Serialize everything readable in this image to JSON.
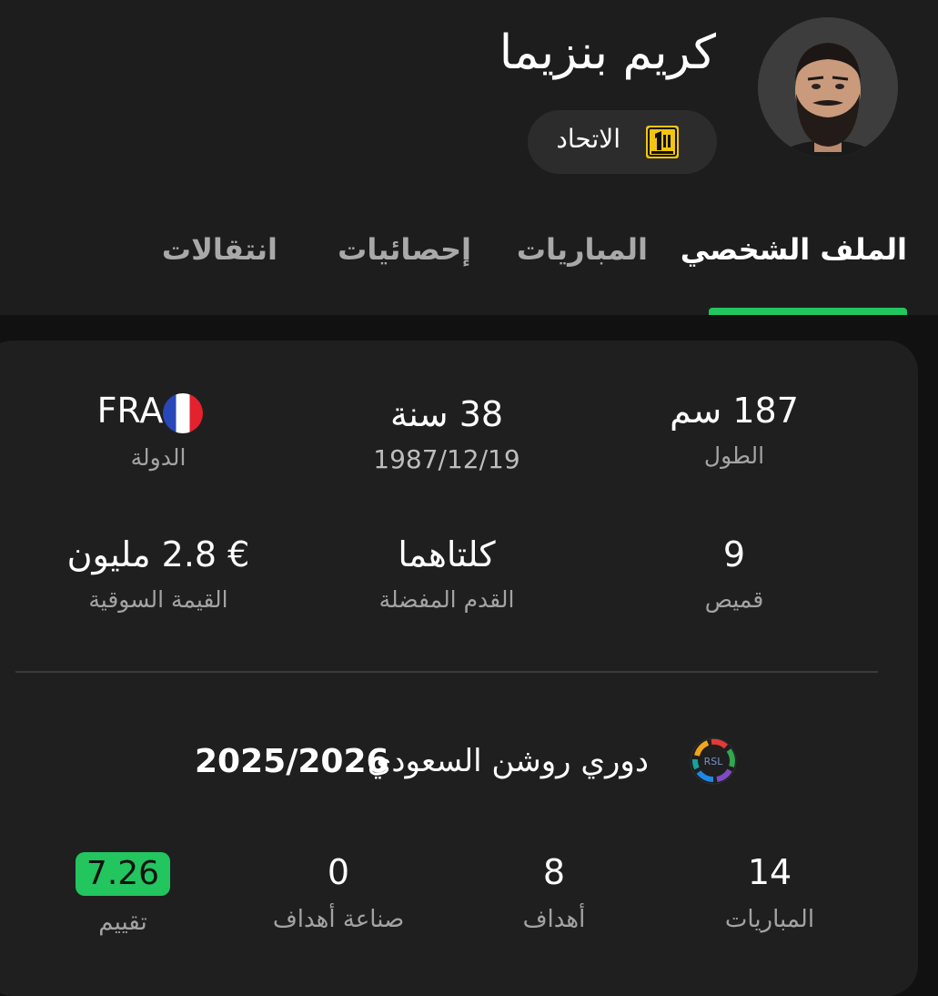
{
  "player": {
    "name": "كريم بنزيما",
    "team": "الاتحاد"
  },
  "tabs": [
    {
      "label": "الملف الشخصي",
      "active": true
    },
    {
      "label": "المباريات",
      "active": false
    },
    {
      "label": "إحصائيات",
      "active": false
    },
    {
      "label": "انتقالات",
      "active": false
    }
  ],
  "profile": {
    "height": {
      "value": "187 سم",
      "label": "الطول"
    },
    "age": {
      "value": "38 سنة",
      "label": "1987/12/19"
    },
    "country": {
      "value": "FRA",
      "label": "الدولة"
    },
    "shirt": {
      "value": "9",
      "label": "قميص"
    },
    "foot": {
      "value": "كلتاهما",
      "label": "القدم المفضلة"
    },
    "market_value": {
      "value": "€ 2.8 مليون",
      "label": "القيمة السوقية"
    }
  },
  "league": {
    "name": "دوري روشن السعودي",
    "season": "2025/2026",
    "logo_text": "RSL"
  },
  "season_stats": {
    "matches": {
      "value": "14",
      "label": "المباريات"
    },
    "goals": {
      "value": "8",
      "label": "أهداف"
    },
    "assists": {
      "value": "0",
      "label": "صناعة أهداف"
    },
    "rating": {
      "value": "7.26",
      "label": "تقييم"
    }
  },
  "colors": {
    "accent": "#22c55e",
    "card": "#1f1f1f",
    "header": "#1d1d1d",
    "team_gold": "#f2c511"
  },
  "icons": {
    "flag": "france-flag-icon",
    "team": "al-ittihad-logo-icon",
    "league": "roshn-saudi-league-logo-icon"
  }
}
